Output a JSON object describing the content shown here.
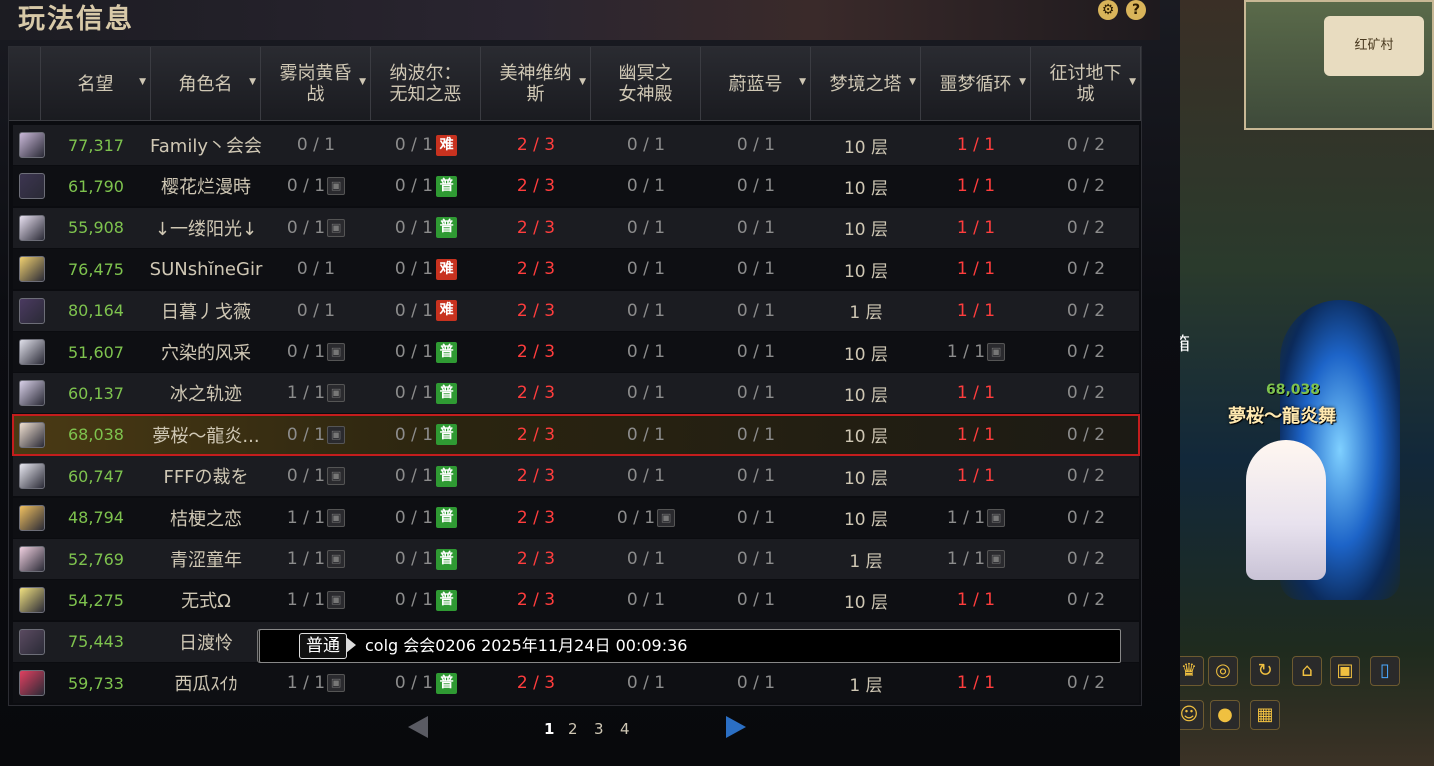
{
  "window": {
    "title": "玩法信息"
  },
  "columns": [
    {
      "label": "名望",
      "sortable": true
    },
    {
      "label": "角色名",
      "sortable": true
    },
    {
      "label": "雾岗黄昏\n战",
      "sortable": true
    },
    {
      "label": "纳波尔：\n无知之恶",
      "sortable": false
    },
    {
      "label": "美神维纳\n斯",
      "sortable": true
    },
    {
      "label": "幽冥之\n女神殿",
      "sortable": false
    },
    {
      "label": "蔚蓝号",
      "sortable": true
    },
    {
      "label": "梦境之塔",
      "sortable": true
    },
    {
      "label": "噩梦循环",
      "sortable": true
    },
    {
      "label": "征讨地下\n城",
      "sortable": true
    }
  ],
  "rows": [
    {
      "fame": "77,317",
      "name": "Family丶会会",
      "c1": "0 / 1",
      "c1_lock": false,
      "c2": "0 / 1",
      "c2_badge": "难",
      "c3": "2 / 3",
      "c4": "0 / 1",
      "c4_lock": false,
      "c5": "0 / 1",
      "c6": "10 层",
      "c7": "1 / 1",
      "c7_red": true,
      "c7_lock": false,
      "c8": "0 / 2"
    },
    {
      "fame": "61,790",
      "name": "樱花烂漫時",
      "c1": "0 / 1",
      "c1_lock": true,
      "c2": "0 / 1",
      "c2_badge": "普",
      "c3": "2 / 3",
      "c4": "0 / 1",
      "c4_lock": false,
      "c5": "0 / 1",
      "c6": "10 层",
      "c7": "1 / 1",
      "c7_red": true,
      "c7_lock": false,
      "c8": "0 / 2"
    },
    {
      "fame": "55,908",
      "name": "↓一缕阳光↓",
      "c1": "0 / 1",
      "c1_lock": true,
      "c2": "0 / 1",
      "c2_badge": "普",
      "c3": "2 / 3",
      "c4": "0 / 1",
      "c4_lock": false,
      "c5": "0 / 1",
      "c6": "10 层",
      "c7": "1 / 1",
      "c7_red": true,
      "c7_lock": false,
      "c8": "0 / 2"
    },
    {
      "fame": "76,475",
      "name": "SUNshĭneGir",
      "c1": "0 / 1",
      "c1_lock": false,
      "c2": "0 / 1",
      "c2_badge": "难",
      "c3": "2 / 3",
      "c4": "0 / 1",
      "c4_lock": false,
      "c5": "0 / 1",
      "c6": "10 层",
      "c7": "1 / 1",
      "c7_red": true,
      "c7_lock": false,
      "c8": "0 / 2"
    },
    {
      "fame": "80,164",
      "name": "日暮丿戈薇",
      "c1": "0 / 1",
      "c1_lock": false,
      "c2": "0 / 1",
      "c2_badge": "难",
      "c3": "2 / 3",
      "c4": "0 / 1",
      "c4_lock": false,
      "c5": "0 / 1",
      "c6": "1 层",
      "c7": "1 / 1",
      "c7_red": true,
      "c7_lock": false,
      "c8": "0 / 2"
    },
    {
      "fame": "51,607",
      "name": "穴染的风采",
      "c1": "0 / 1",
      "c1_lock": true,
      "c2": "0 / 1",
      "c2_badge": "普",
      "c3": "2 / 3",
      "c4": "0 / 1",
      "c4_lock": false,
      "c5": "0 / 1",
      "c6": "10 层",
      "c7": "1 / 1",
      "c7_red": false,
      "c7_lock": true,
      "c8": "0 / 2"
    },
    {
      "fame": "60,137",
      "name": "冰之轨迹",
      "c1": "1 / 1",
      "c1_lock": true,
      "c2": "0 / 1",
      "c2_badge": "普",
      "c3": "2 / 3",
      "c4": "0 / 1",
      "c4_lock": false,
      "c5": "0 / 1",
      "c6": "10 层",
      "c7": "1 / 1",
      "c7_red": true,
      "c7_lock": false,
      "c8": "0 / 2"
    },
    {
      "fame": "68,038",
      "name": "夢桜～龍炎...",
      "c1": "0 / 1",
      "c1_lock": true,
      "c2": "0 / 1",
      "c2_badge": "普",
      "c3": "2 / 3",
      "c4": "0 / 1",
      "c4_lock": false,
      "c5": "0 / 1",
      "c6": "10 层",
      "c7": "1 / 1",
      "c7_red": true,
      "c7_lock": false,
      "c8": "0 / 2",
      "selected": true
    },
    {
      "fame": "60,747",
      "name": "FFFの裁を",
      "c1": "0 / 1",
      "c1_lock": true,
      "c2": "0 / 1",
      "c2_badge": "普",
      "c3": "2 / 3",
      "c4": "0 / 1",
      "c4_lock": false,
      "c5": "0 / 1",
      "c6": "10 层",
      "c7": "1 / 1",
      "c7_red": true,
      "c7_lock": false,
      "c8": "0 / 2"
    },
    {
      "fame": "48,794",
      "name": "桔梗之恋",
      "c1": "1 / 1",
      "c1_lock": true,
      "c2": "0 / 1",
      "c2_badge": "普",
      "c3": "2 / 3",
      "c4": "0 / 1",
      "c4_lock": true,
      "c5": "0 / 1",
      "c6": "10 层",
      "c7": "1 / 1",
      "c7_red": false,
      "c7_lock": true,
      "c8": "0 / 2"
    },
    {
      "fame": "52,769",
      "name": "青涩童年",
      "c1": "1 / 1",
      "c1_lock": true,
      "c2": "0 / 1",
      "c2_badge": "普",
      "c3": "2 / 3",
      "c4": "0 / 1",
      "c4_lock": false,
      "c5": "0 / 1",
      "c6": "1 层",
      "c7": "1 / 1",
      "c7_red": false,
      "c7_lock": true,
      "c8": "0 / 2"
    },
    {
      "fame": "54,275",
      "name": "无式Ω",
      "c1": "1 / 1",
      "c1_lock": true,
      "c2": "0 / 1",
      "c2_badge": "普",
      "c3": "2 / 3",
      "c4": "0 / 1",
      "c4_lock": false,
      "c5": "0 / 1",
      "c6": "10 层",
      "c7": "1 / 1",
      "c7_red": true,
      "c7_lock": false,
      "c8": "0 / 2"
    },
    {
      "fame": "75,443",
      "name": "日渡怜",
      "chat_row": true
    },
    {
      "fame": "59,733",
      "name": "西瓜ｽｲｶ",
      "c1": "1 / 1",
      "c1_lock": true,
      "c2": "0 / 1",
      "c2_badge": "普",
      "c3": "2 / 3",
      "c4": "0 / 1",
      "c4_lock": false,
      "c5": "0 / 1",
      "c6": "1 层",
      "c7": "1 / 1",
      "c7_red": true,
      "c7_lock": false,
      "c8": "0 / 2"
    }
  ],
  "chat": {
    "channel": "普通",
    "text": "colg 会会0206 2025年11月24日 00:09:36"
  },
  "pagination": {
    "pages": [
      "1",
      "2",
      "3",
      "4"
    ],
    "current": "1"
  },
  "scene": {
    "minimap_label": "红矿村",
    "char_name": "夢桜～龍炎舞",
    "char_fame": "68,038",
    "side_text": "箱"
  },
  "colors": {
    "fame_green": "#7ec34e",
    "red_value": "#ff3d3d",
    "badge_hard": "#c8321f",
    "badge_normal": "#2f9a33",
    "selected_outline": "#c41d1d"
  }
}
